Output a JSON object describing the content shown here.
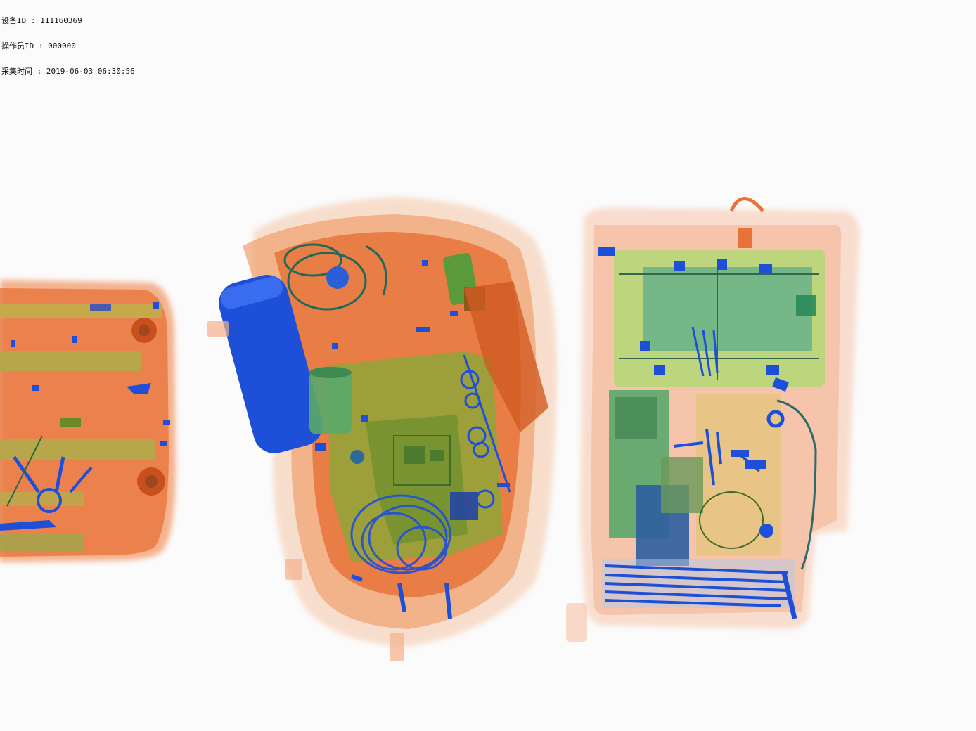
{
  "header": {
    "device_id_line": "设备ID : 111160369",
    "operator_id_line": "操作员ID : 000000",
    "capture_time_line": "采集时间 : 2019-06-03 06:30:56"
  },
  "scan": {
    "colors": {
      "background": "#fbfbfb",
      "organic": "#e8733a",
      "organic_light": "#f3b08a",
      "mixed": "#8aa83a",
      "mixed_light": "#b9d67a",
      "inorganic": "#1d4fd8",
      "inorganic_dark": "#16309a",
      "board_green": "#5aa86a"
    }
  }
}
